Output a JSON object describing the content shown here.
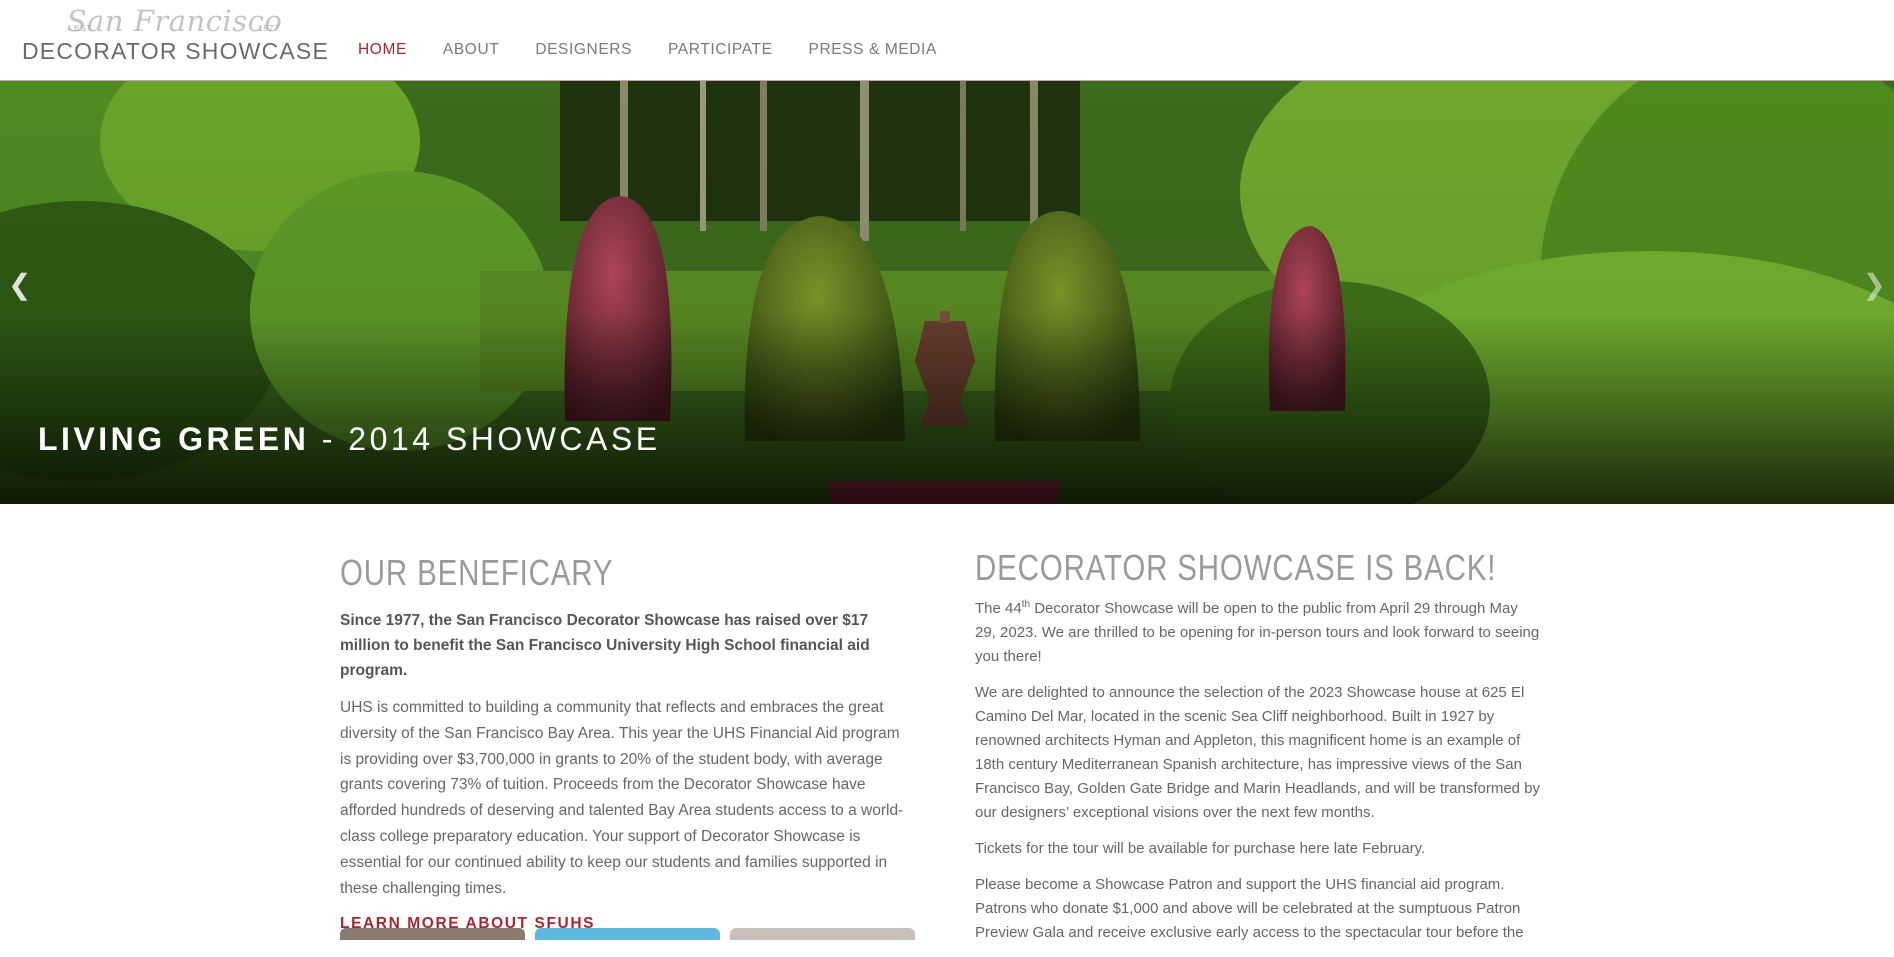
{
  "header": {
    "logo": {
      "script": "San Francisco",
      "est": "EST",
      "year": "1977",
      "name": "DECORATOR SHOWCASE"
    },
    "nav": [
      {
        "label": "HOME",
        "active": true
      },
      {
        "label": "ABOUT",
        "active": false
      },
      {
        "label": "DESIGNERS",
        "active": false
      },
      {
        "label": "PARTICIPATE",
        "active": false
      },
      {
        "label": "PRESS & MEDIA",
        "active": false
      }
    ]
  },
  "hero": {
    "title_bold": "LIVING GREEN",
    "title_rest": " - 2014 SHOWCASE",
    "prev_icon": "chevron-left-icon",
    "next_icon": "chevron-right-icon"
  },
  "beneficiary": {
    "heading": "OUR BENEFICARY",
    "lead": "Since 1977, the San Francisco Decorator Showcase has raised over $17 million to benefit the San Francisco University High School financial aid program.",
    "body": "UHS is committed to building a community that reflects and embraces the great diversity of the San Francisco Bay Area. This year the UHS Financial Aid program is providing over $3,700,000 in grants to 20% of the student body, with average grants covering 73% of tuition. Proceeds from the Decorator Showcase have afforded hundreds of deserving and talented Bay Area students access to a world-class college preparatory education. Your support of Decorator Showcase is essential for our continued ability to keep our students and families supported in these challenging times.",
    "link": "LEARN MORE ABOUT SFUHS"
  },
  "news": {
    "heading": "DECORATOR SHOWCASE IS BACK!",
    "p1_a": "The 44",
    "p1_sup": "th",
    "p1_b": " Decorator Showcase will be open to the public from April 29 through May 29, 2023.  We are thrilled to be opening for in-person tours and look forward to seeing you there!",
    "p2": "We are delighted to announce the selection of the 2023 Showcase house at 625 El Camino Del Mar, located in the scenic Sea Cliff neighborhood.  Built in 1927 by renowned architects Hyman and Appleton, this magnificent home is an example of 18th century Mediterranean Spanish architecture, has impressive views of the San Francisco Bay, Golden Gate Bridge and Marin Headlands, and will be transformed by our designers’ exceptional visions over the next few months.",
    "p3": "Tickets for the tour will be available for purchase here late February.",
    "p4": "Please become a Showcase Patron and support the UHS financial aid program. Patrons who donate $1,000 and above will be celebrated at the sumptuous Patron Preview Gala and receive exclusive early access to the spectacular tour before the"
  },
  "colors": {
    "accent": "#a52733",
    "heading": "#9a9a9a",
    "text": "#666666"
  }
}
